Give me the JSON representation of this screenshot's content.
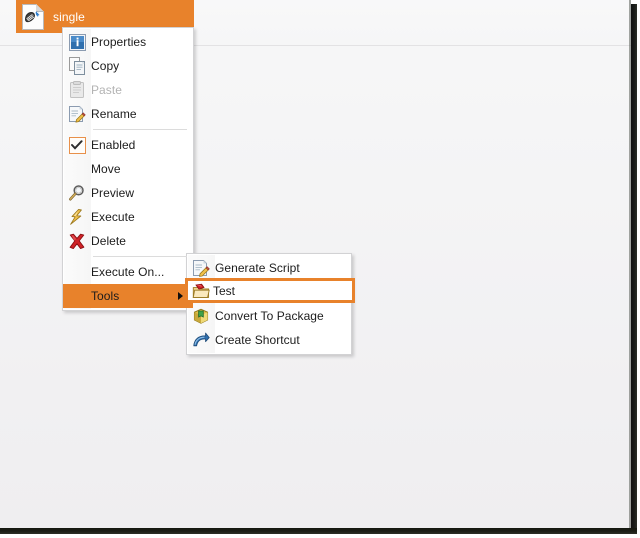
{
  "window": {
    "background_color": "#f4f4f5",
    "edge_shadow_color": "#1b1d1a"
  },
  "tree_node": {
    "label": "single",
    "icon": "document-plus-icon",
    "selected": true,
    "selected_color": "#e8822b",
    "label_color": "#ffffff"
  },
  "context_menu": {
    "name": "item-context-menu",
    "highlight_color": "#e8822b",
    "items": [
      {
        "label": "Properties",
        "icon": "info-icon",
        "enabled": true,
        "type": "item"
      },
      {
        "label": "Copy",
        "icon": "copy-icon",
        "enabled": true,
        "type": "item"
      },
      {
        "label": "Paste",
        "icon": "paste-icon",
        "enabled": false,
        "type": "item"
      },
      {
        "label": "Rename",
        "icon": "rename-icon",
        "enabled": true,
        "type": "item"
      },
      {
        "label": "",
        "icon": "",
        "enabled": true,
        "type": "separator"
      },
      {
        "label": "Enabled",
        "icon": "checkbox-checked-icon",
        "enabled": true,
        "type": "checkbox",
        "checked": true
      },
      {
        "label": "Move",
        "icon": "",
        "enabled": true,
        "type": "item"
      },
      {
        "label": "Preview",
        "icon": "magnifier-icon",
        "enabled": true,
        "type": "item"
      },
      {
        "label": "Execute",
        "icon": "lightning-icon",
        "enabled": true,
        "type": "item"
      },
      {
        "label": "Delete",
        "icon": "red-x-icon",
        "enabled": true,
        "type": "item"
      },
      {
        "label": "",
        "icon": "",
        "enabled": true,
        "type": "separator"
      },
      {
        "label": "Execute On...",
        "icon": "",
        "enabled": true,
        "type": "item"
      },
      {
        "label": "Tools",
        "icon": "",
        "enabled": true,
        "type": "submenu",
        "highlighted": true,
        "arrow": "chevron-right-icon"
      }
    ]
  },
  "submenu": {
    "name": "tools-submenu",
    "parent": "Tools",
    "hover_border_color": "#e8822b",
    "items": [
      {
        "label": "Generate Script",
        "icon": "script-pencil-icon",
        "hovered": false
      },
      {
        "label": "Test",
        "icon": "test-folder-icon",
        "hovered": true
      },
      {
        "label": "Convert To Package",
        "icon": "package-box-icon",
        "hovered": false
      },
      {
        "label": "Create Shortcut",
        "icon": "shortcut-arrow-icon",
        "hovered": false
      }
    ]
  }
}
